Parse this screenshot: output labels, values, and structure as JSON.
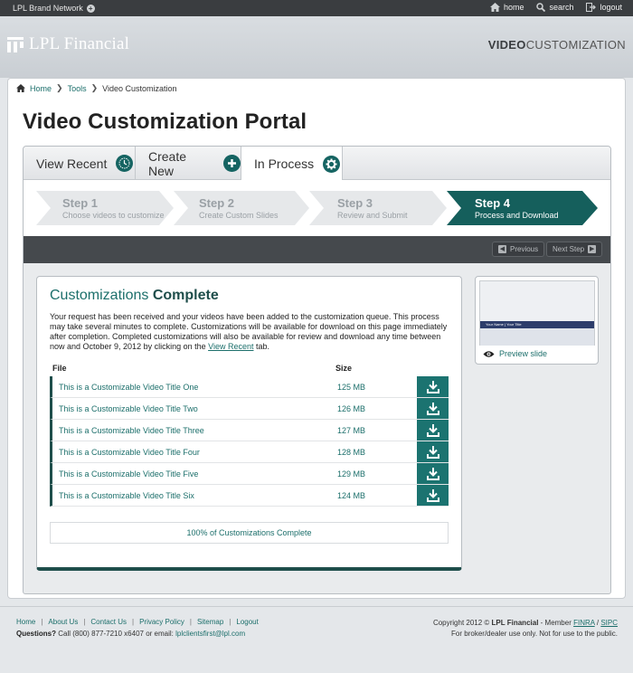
{
  "topbar": {
    "brand_network": "LPL Brand Network",
    "links": [
      {
        "label": "home",
        "icon": "home-icon"
      },
      {
        "label": "search",
        "icon": "search-icon"
      },
      {
        "label": "logout",
        "icon": "logout-icon"
      }
    ]
  },
  "header": {
    "logo_text": "LPL Financial",
    "product_bold": "VIDEO",
    "product_light": "CUSTOMIZATION"
  },
  "breadcrumb": [
    {
      "label": "Home"
    },
    {
      "label": "Tools"
    },
    {
      "label": "Video Customization"
    }
  ],
  "page_title": "Video Customization Portal",
  "tabs": [
    {
      "label": "View Recent",
      "icon": "clock-icon"
    },
    {
      "label": "Create New",
      "icon": "plus-icon"
    },
    {
      "label": "In Process",
      "icon": "gear-icon",
      "active": true
    }
  ],
  "steps": [
    {
      "title": "Step 1",
      "subtitle": "Choose videos to customize"
    },
    {
      "title": "Step 2",
      "subtitle": "Create Custom Slides"
    },
    {
      "title": "Step 3",
      "subtitle": "Review and Submit"
    },
    {
      "title": "Step 4",
      "subtitle": "Process and Download",
      "active": true
    }
  ],
  "step_nav": {
    "previous": "Previous",
    "next": "Next Step"
  },
  "content": {
    "heading_light": "Customizations",
    "heading_bold": "Complete",
    "message_before_link": "Your request has been received and your videos have been added to the customization queue.  This process may take several minutes to complete.  Customizations will be available for download on this page immediately after completion.  Completed customizations will also be available for review and download any time between now and October 9, 2012 by clicking on the ",
    "message_link": "View Recent",
    "message_after_link": " tab.",
    "col_file": "File",
    "col_size": "Size",
    "files": [
      {
        "name": "This is a Customizable Video Title One",
        "size": "125 MB"
      },
      {
        "name": "This is a Customizable Video Title Two",
        "size": "126 MB"
      },
      {
        "name": "This is a Customizable Video Title Three",
        "size": "127 MB"
      },
      {
        "name": "This is a Customizable Video Title Four",
        "size": "128 MB"
      },
      {
        "name": "This is a Customizable Video Title Five",
        "size": "129 MB"
      },
      {
        "name": "This is a Customizable Video Title Six",
        "size": "124 MB"
      }
    ],
    "progress_text": "100% of Customizations Complete"
  },
  "preview": {
    "label": "Preview slide",
    "band_name": "Your Name",
    "band_title": "Your Title"
  },
  "footer": {
    "links": [
      "Home",
      "About Us",
      "Contact Us",
      "Privacy Policy",
      "Sitemap",
      "Logout"
    ],
    "questions_label": "Questions?",
    "questions_text": " Call (800) 877-7210 x6407 or email: ",
    "email": "lplclientsfirst@lpl.com",
    "copyright_pre": "Copyright 2012 © ",
    "copyright_bold": "LPL Financial",
    "member_text": "  -  Member ",
    "finra": "FINRA",
    "slash": " / ",
    "sipc": "SIPC",
    "disclaimer": "For broker/dealer use only. Not for use to the public."
  },
  "colors": {
    "accent_teal": "#1b7370",
    "dark_teal": "#1f4e4b",
    "topbar": "#3a3d40",
    "step_nav": "#45494d"
  }
}
